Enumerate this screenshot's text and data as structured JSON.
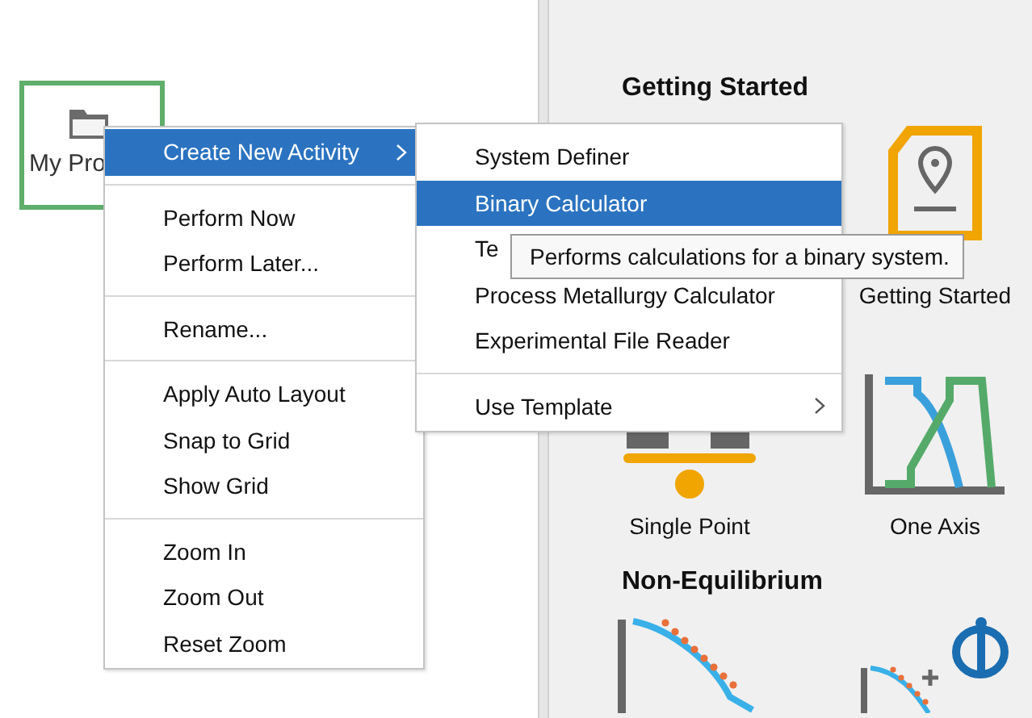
{
  "canvas": {
    "nodes": [
      {
        "label": "My Pro",
        "selected": true
      }
    ]
  },
  "panel": {
    "sections": [
      {
        "title": "Getting Started",
        "tiles": [
          {
            "kind": "getting-started",
            "label": "Getting Started"
          }
        ]
      },
      {
        "tiles": [
          {
            "kind": "single-point",
            "label": "Single Point"
          },
          {
            "kind": "one-axis",
            "label": "One Axis"
          }
        ]
      },
      {
        "title": "Non-Equilibrium",
        "tiles": [
          {
            "kind": "scheil"
          },
          {
            "kind": "diffusion"
          }
        ]
      }
    ]
  },
  "context_menu": {
    "groups": [
      [
        {
          "label": "Create New Activity",
          "selected": true,
          "submenu": true
        }
      ],
      [
        {
          "label": "Perform Now",
          "selected": false,
          "submenu": false
        },
        {
          "label": "Perform Later...",
          "selected": false,
          "submenu": false
        }
      ],
      [
        {
          "label": "Rename...",
          "selected": false,
          "submenu": false
        }
      ],
      [
        {
          "label": "Apply Auto Layout",
          "selected": false,
          "submenu": false
        },
        {
          "label": "Snap to Grid",
          "selected": false,
          "submenu": false
        },
        {
          "label": "Show Grid",
          "selected": false,
          "submenu": false
        }
      ],
      [
        {
          "label": "Zoom In",
          "selected": false,
          "submenu": false
        },
        {
          "label": "Zoom Out",
          "selected": false,
          "submenu": false
        },
        {
          "label": "Reset Zoom",
          "selected": false,
          "submenu": false
        }
      ]
    ]
  },
  "submenu": {
    "groups": [
      [
        {
          "label": "System Definer",
          "selected": false,
          "submenu": false
        },
        {
          "label": "Binary Calculator",
          "selected": true,
          "submenu": false
        },
        {
          "label": "Te",
          "selected": false,
          "submenu": false
        },
        {
          "label": "Process Metallurgy Calculator",
          "selected": false,
          "submenu": false
        },
        {
          "label": "Experimental File Reader",
          "selected": false,
          "submenu": false
        }
      ],
      [
        {
          "label": "Use Template",
          "selected": false,
          "submenu": true
        }
      ]
    ]
  },
  "tooltip": {
    "text": "Performs calculations for a binary system."
  }
}
